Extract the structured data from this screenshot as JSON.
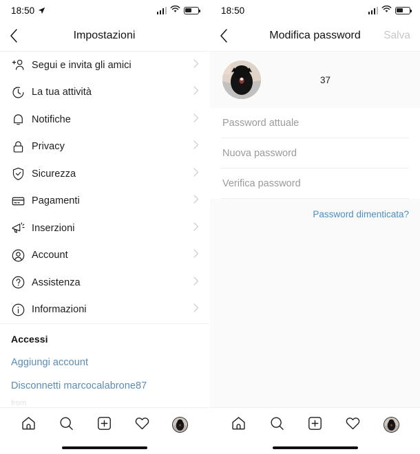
{
  "left": {
    "status_bar": {
      "time": "18:50",
      "location_icon": "location-arrow-icon",
      "signal_icon": "cellular-signal-icon",
      "wifi_icon": "wifi-icon",
      "battery_icon": "battery-icon"
    },
    "nav": {
      "back_icon": "chevron-left-icon",
      "title": "Impostazioni"
    },
    "items": [
      {
        "label": "Segui e invita gli amici",
        "icon": "add-person-icon"
      },
      {
        "label": "La tua attività",
        "icon": "clock-activity-icon"
      },
      {
        "label": "Notifiche",
        "icon": "bell-icon"
      },
      {
        "label": "Privacy",
        "icon": "lock-icon"
      },
      {
        "label": "Sicurezza",
        "icon": "shield-check-icon"
      },
      {
        "label": "Pagamenti",
        "icon": "credit-card-icon"
      },
      {
        "label": "Inserzioni",
        "icon": "megaphone-icon"
      },
      {
        "label": "Account",
        "icon": "person-circle-icon"
      },
      {
        "label": "Assistenza",
        "icon": "question-circle-icon"
      },
      {
        "label": "Informazioni",
        "icon": "info-circle-icon"
      }
    ],
    "accounts_section": {
      "heading": "Accessi",
      "add_account": "Aggiungi account",
      "logout": "Disconnetti marcocalabrone87",
      "cutoff_text": "from"
    }
  },
  "right": {
    "status_bar": {
      "time": "18:50",
      "signal_icon": "cellular-signal-icon",
      "wifi_icon": "wifi-icon",
      "battery_icon": "battery-icon"
    },
    "nav": {
      "back_icon": "chevron-left-icon",
      "title": "Modifica password",
      "save_label": "Salva"
    },
    "profile": {
      "avatar_alt": "user-profile-photo",
      "username": "37"
    },
    "form": {
      "current_password_placeholder": "Password attuale",
      "current_password_value": "",
      "new_password_placeholder": "Nuova password",
      "new_password_value": "",
      "confirm_password_placeholder": "Verifica password",
      "confirm_password_value": "",
      "forgot_link": "Password dimenticata?"
    }
  },
  "tabbar": {
    "home_icon": "home-icon",
    "search_icon": "search-icon",
    "add_icon": "plus-square-icon",
    "activity_icon": "heart-icon",
    "profile_icon": "profile-avatar-icon"
  },
  "colors": {
    "link_blue": "#4a8ec2",
    "muted_link": "#5a8cb5",
    "disabled_gray": "#c7c7cc",
    "panel_gray": "#fafafa",
    "divider": "#efefef",
    "text": "#121212"
  }
}
